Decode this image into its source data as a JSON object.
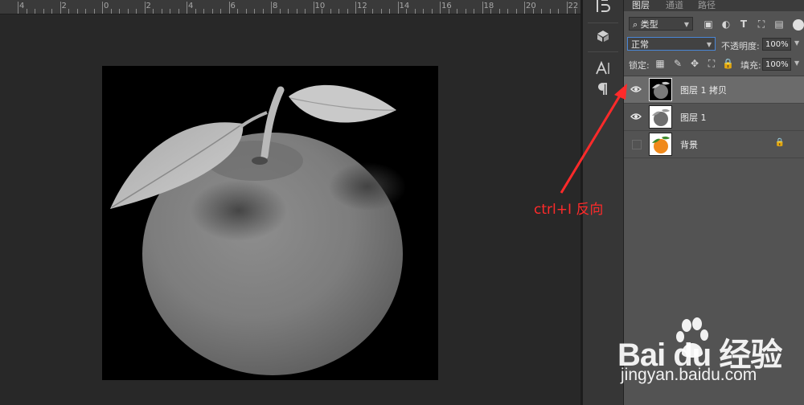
{
  "ruler": {
    "labels": [
      "4",
      "2",
      "0",
      "2",
      "4",
      "6",
      "8",
      "10",
      "12",
      "14",
      "16",
      "18",
      "20",
      "22"
    ]
  },
  "tools": [
    "history-icon",
    "3d-icon",
    "character-icon",
    "paragraph-icon"
  ],
  "panel": {
    "tabs": [
      "图层",
      "通道",
      "路径"
    ],
    "filter": {
      "kind_label": "类型"
    },
    "blend_mode": "正常",
    "opacity_label": "不透明度:",
    "opacity_value": "100%",
    "lock_label": "锁定:",
    "fill_label": "填充:",
    "fill_value": "100%",
    "layers": [
      {
        "name": "图层 1 拷贝",
        "visible": true,
        "selected": true,
        "locked": false,
        "thumb": "inverted-orange"
      },
      {
        "name": "图层 1",
        "visible": true,
        "selected": false,
        "locked": false,
        "thumb": "gray-orange"
      },
      {
        "name": "背景",
        "visible": false,
        "selected": false,
        "locked": true,
        "thumb": "color-orange"
      }
    ]
  },
  "annotation": {
    "text": "ctrl+I 反向",
    "color": "#ff2a2a"
  },
  "watermark": {
    "brand": "Bai du 经验",
    "url": "jingyan.baidu.com"
  },
  "colors": {
    "canvas_bg": "#000000",
    "workspace": "#282828",
    "panel": "#535353",
    "selected_layer": "#6b6b6b",
    "accent": "#ff2a2a"
  }
}
